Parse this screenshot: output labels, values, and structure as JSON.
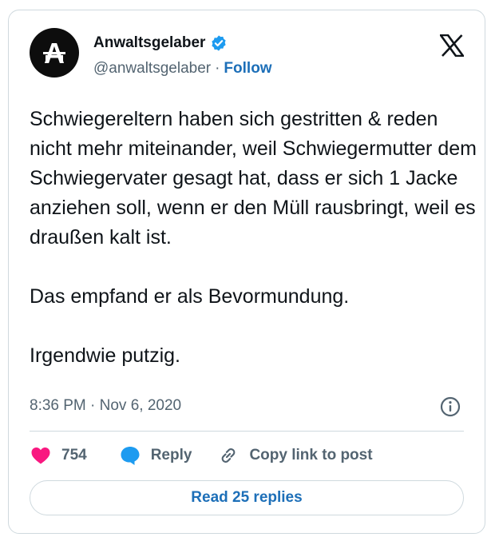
{
  "author": {
    "name": "Anwaltsgelaber",
    "handle": "@anwaltsgelaber",
    "separator": "·",
    "follow_label": "Follow",
    "avatar_letter": "A",
    "verified": true
  },
  "tweet": {
    "text": "Schwiegereltern haben sich gestritten & reden nicht mehr miteinander, weil Schwiegermutter dem Schwiegervater gesagt hat, dass er sich 1 Jacke anziehen soll, wenn er den Müll rausbringt, weil es draußen kalt ist.\n\nDas empfand er als Bevormundung.\n\nIrgendwie putzig.",
    "timestamp": "8:36 PM · Nov 6, 2020"
  },
  "actions": {
    "like_count": "754",
    "reply_label": "Reply",
    "copy_label": "Copy link to post"
  },
  "footer": {
    "read_replies_label": "Read 25 replies"
  },
  "icons": {
    "logo": "x-logo-icon",
    "verified": "verified-badge-icon",
    "info": "info-icon",
    "like": "heart-icon",
    "reply": "speech-bubble-icon",
    "copy": "link-icon"
  },
  "colors": {
    "like": "#f91880",
    "reply": "#1d9bf0",
    "link": "#1d6fb8",
    "secondary": "#536471",
    "verified": "#1d9bf0"
  }
}
